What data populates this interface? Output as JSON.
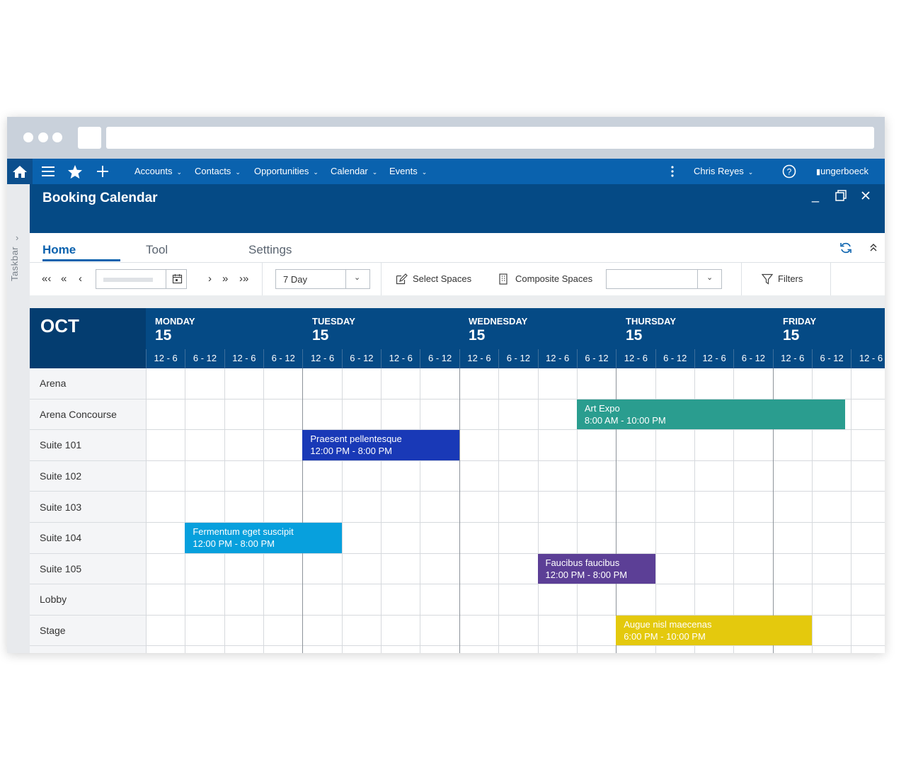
{
  "nav": {
    "menus": [
      "Accounts",
      "Contacts",
      "Opportunities",
      "Calendar",
      "Events"
    ],
    "user": "Chris Reyes",
    "brand": "ungerboeck"
  },
  "sidebar": {
    "label": "Taskbar"
  },
  "window": {
    "title": "Booking Calendar"
  },
  "tabs": {
    "home": "Home",
    "tool": "Tool",
    "settings": "Settings"
  },
  "toolbar": {
    "view_select": "7 Day",
    "select_spaces": "Select Spaces",
    "composite_spaces": "Composite Spaces",
    "filters": "Filters"
  },
  "calendar": {
    "month": "OCT",
    "days": [
      {
        "name": "MONDAY",
        "date": "15"
      },
      {
        "name": "TUESDAY",
        "date": "15"
      },
      {
        "name": "WEDNESDAY",
        "date": "15"
      },
      {
        "name": "THURSDAY",
        "date": "15"
      },
      {
        "name": "FRIDAY",
        "date": "15"
      }
    ],
    "slots": [
      "12 - 6",
      "6 - 12",
      "12 - 6",
      "6 - 12",
      "12 - 6",
      "6 - 12",
      "12 - 6",
      "6 - 12",
      "12 - 6",
      "6 - 12",
      "12 - 6",
      "6 - 12",
      "12 - 6",
      "6 - 12",
      "12 - 6",
      "6 - 12",
      "12 - 6",
      "6 - 12",
      "12 - 6"
    ],
    "rooms": [
      "Arena",
      "Arena Concourse",
      "Suite 101",
      "Suite 102",
      "Suite 103",
      "Suite 104",
      "Suite 105",
      "Lobby",
      "Stage"
    ],
    "events": [
      {
        "name": "Art Expo",
        "time": "8:00 AM - 10:00 PM",
        "room": "Arena Concourse",
        "color": "#2a9d8f"
      },
      {
        "name": "Praesent pellentesque",
        "time": "12:00 PM - 8:00 PM",
        "room": "Suite 101",
        "color": "#1939b7"
      },
      {
        "name": "Fermentum eget suscipit",
        "time": "12:00 PM - 8:00 PM",
        "room": "Suite 104",
        "color": "#07a0dd"
      },
      {
        "name": "Faucibus faucibus",
        "time": "12:00 PM - 8:00 PM",
        "room": "Suite 105",
        "color": "#5c3f96"
      },
      {
        "name": "Augue nisl maecenas",
        "time": "6:00 PM - 10:00 PM",
        "room": "Stage",
        "color": "#e4c90d"
      }
    ]
  }
}
